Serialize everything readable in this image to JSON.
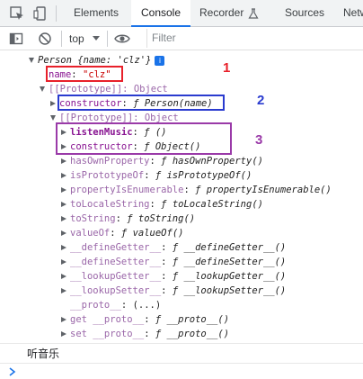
{
  "tabs": [
    {
      "label": "Elements"
    },
    {
      "label": "Console"
    },
    {
      "label": "Recorder"
    },
    {
      "label": "Sources"
    },
    {
      "label": "Netw"
    }
  ],
  "toolbar": {
    "context": "top",
    "filter_placeholder": "Filter"
  },
  "tree": {
    "person_header": "Person {name: 'clz'}",
    "name_key": "name",
    "name_value": "\"clz\"",
    "proto1": "[[Prototype]]: Object",
    "ctor_key": "constructor",
    "ctor_value": "ƒ Person(name)",
    "proto2": "[[Prototype]]: Object",
    "listen_key": "listenMusic",
    "listen_value": "ƒ ()",
    "ctor2_key": "constructor",
    "ctor2_value": "ƒ Object()",
    "items": [
      {
        "key": "hasOwnProperty",
        "value": "ƒ hasOwnProperty()"
      },
      {
        "key": "isPrototypeOf",
        "value": "ƒ isPrototypeOf()"
      },
      {
        "key": "propertyIsEnumerable",
        "value": "ƒ propertyIsEnumerable()"
      },
      {
        "key": "toLocaleString",
        "value": "ƒ toLocaleString()"
      },
      {
        "key": "toString",
        "value": "ƒ toString()"
      },
      {
        "key": "valueOf",
        "value": "ƒ valueOf()"
      },
      {
        "key": "__defineGetter__",
        "value": "ƒ __defineGetter__()"
      },
      {
        "key": "__defineSetter__",
        "value": "ƒ __defineSetter__()"
      },
      {
        "key": "__lookupGetter__",
        "value": "ƒ __lookupGetter__()"
      },
      {
        "key": "__lookupSetter__",
        "value": "ƒ __lookupSetter__()"
      }
    ],
    "proto_getter_key": "__proto__",
    "proto_getter_value": "(...)",
    "get_proto_key": "get __proto__",
    "get_proto_value": "ƒ __proto__()",
    "set_proto_key": "set __proto__",
    "set_proto_value": "ƒ __proto__()"
  },
  "annotations": {
    "label1": "1",
    "label2": "2",
    "label3": "3",
    "color1": "#e8202a",
    "color2": "#2a3bcf",
    "color3": "#9a3aa8"
  },
  "log_output": "听音乐"
}
